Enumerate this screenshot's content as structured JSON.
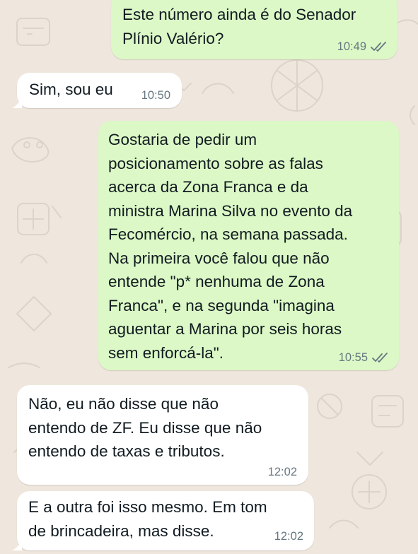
{
  "messages": [
    {
      "direction": "out",
      "lines": [
        "Este número ainda é do Senador",
        "Plínio Valério?"
      ],
      "time": "10:49",
      "status_icon": "read-receipt-double-check-icon"
    },
    {
      "direction": "in",
      "lines": [
        "Sim, sou eu"
      ],
      "time": "10:50"
    },
    {
      "direction": "out",
      "lines": [
        "Gostaria de pedir um",
        "posicionamento sobre as falas",
        "acerca da Zona Franca e da",
        "ministra Marina Silva no evento da",
        "Fecomércio, na semana passada.",
        "Na primeira você falou que não",
        "entende \"p* nenhuma de Zona",
        "Franca\", e na segunda \"imagina",
        "aguentar a Marina por seis horas",
        "sem enforcá-la\"."
      ],
      "time": "10:55",
      "status_icon": "read-receipt-double-check-icon"
    },
    {
      "direction": "in",
      "lines": [
        "Não, eu não disse que não",
        "entendo de ZF. Eu disse que não",
        "entendo de taxas e tributos."
      ],
      "time": "12:02"
    },
    {
      "direction": "in",
      "lines": [
        "E a outra foi isso mesmo. Em tom",
        "de brincadeira, mas disse."
      ],
      "time": "12:02"
    }
  ],
  "colors": {
    "background": "#efe7dd",
    "outgoing_bubble": "#dcf8c6",
    "incoming_bubble": "#ffffff",
    "text": "#111b21",
    "meta": "#667781"
  }
}
